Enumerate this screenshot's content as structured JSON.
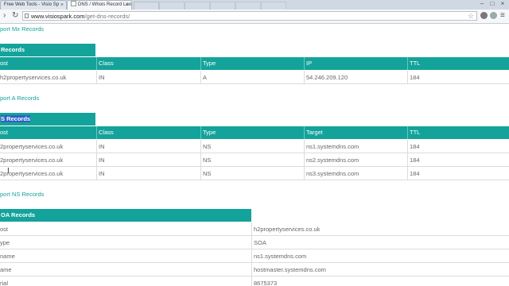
{
  "browser": {
    "tabs": [
      {
        "title": "Free Web Tools - Visio Sp"
      },
      {
        "title": "DNS / Whois Record Loo"
      }
    ],
    "url_domain": "www.visiospark.com",
    "url_path": "/get-dns-records/"
  },
  "links": {
    "mx_export": "port Mx Records",
    "a_export": "port A Records",
    "ns_export": "port NS Records"
  },
  "tables": {
    "a": {
      "caption": "Records",
      "headers": [
        "ost",
        "Class",
        "Type",
        "IP",
        "TTL"
      ],
      "rows": [
        [
          "h2propertyservices.co.uk",
          "IN",
          "A",
          "54.246.209.120",
          "184"
        ]
      ]
    },
    "ns": {
      "caption_left": "",
      "caption_selected": "S Records",
      "headers": [
        "ost",
        "Class",
        "Type",
        "Target",
        "TTL"
      ],
      "rows": [
        [
          "2propertyservices.co.uk",
          "IN",
          "NS",
          "ns1.systemdns.com",
          "184"
        ],
        [
          "2propertyservices.co.uk",
          "IN",
          "NS",
          "ns2.systemdns.com",
          "184"
        ],
        [
          "2propertyservices.co.uk",
          "IN",
          "NS",
          "ns3.systemdns.com",
          "184"
        ]
      ]
    },
    "soa": {
      "caption": "OA Records",
      "rows": [
        [
          "ost",
          "h2propertyservices.co.uk"
        ],
        [
          "ype",
          "SOA"
        ],
        [
          "name",
          "ns1.systemdns.com"
        ],
        [
          "ame",
          "hostmaster.systemdns.com"
        ],
        [
          "rial",
          "8675373"
        ]
      ]
    }
  }
}
